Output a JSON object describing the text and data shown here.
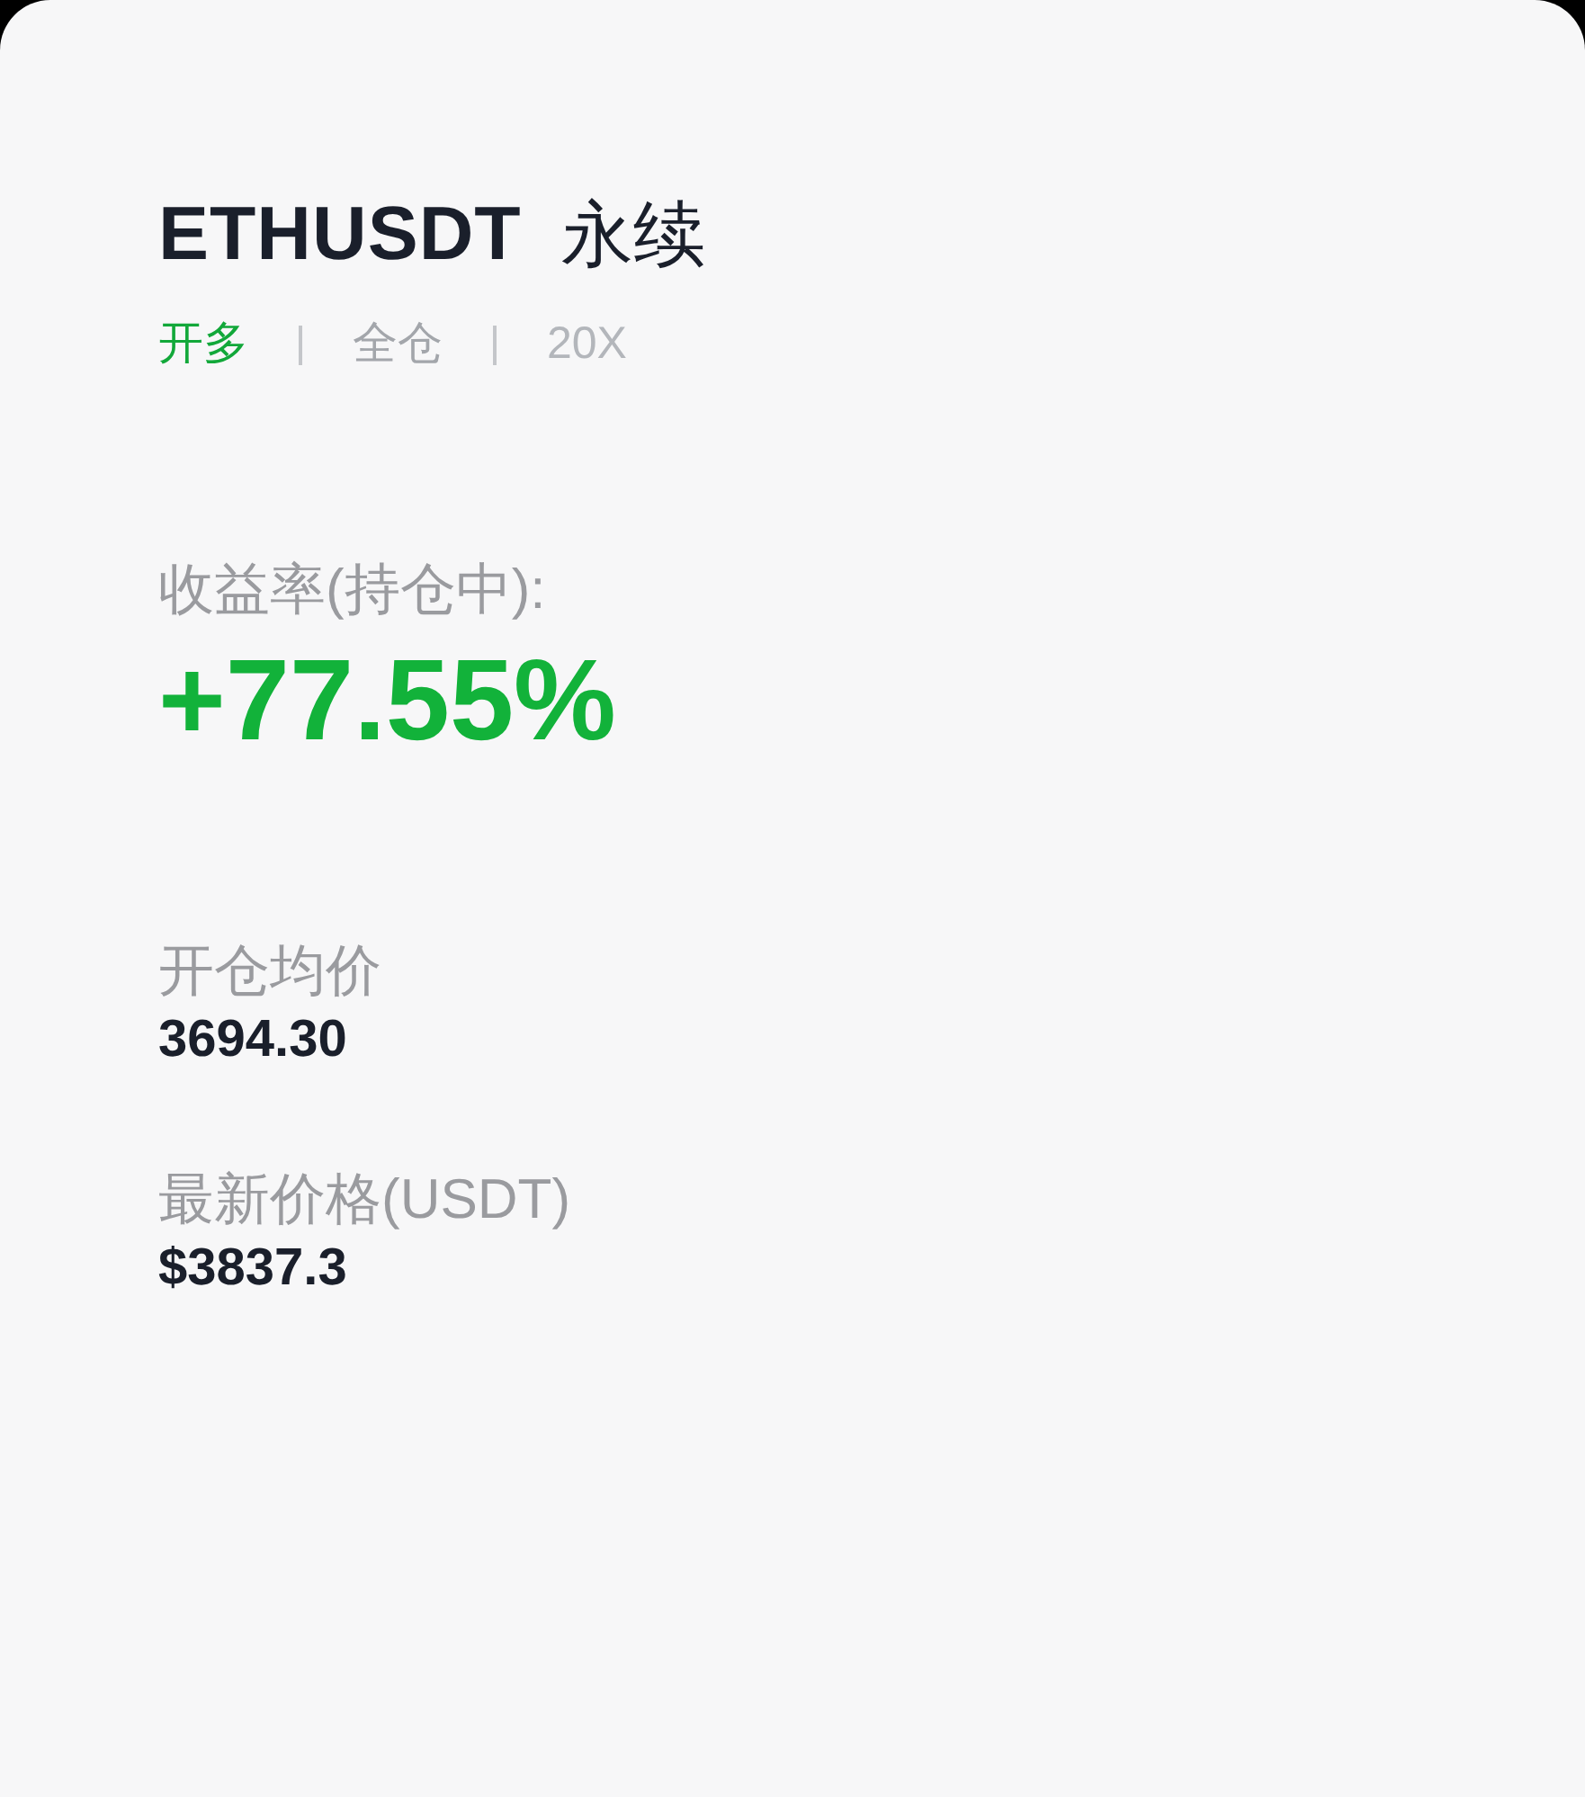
{
  "header": {
    "symbol": "ETHUSDT",
    "contract": "永续"
  },
  "tags": [
    {
      "label": "开多",
      "color": "#12a83a"
    },
    {
      "label": "全仓",
      "color": "#a3a6ab"
    },
    {
      "label": "20X",
      "color": "#b3b6bb"
    }
  ],
  "pnl": {
    "label": "收益率(持仓中):",
    "value": "+77.55%"
  },
  "fields": [
    {
      "label": "开仓均价",
      "value": "3694.30"
    },
    {
      "label": "最新价格(USDT)",
      "value": "$3837.3"
    }
  ]
}
